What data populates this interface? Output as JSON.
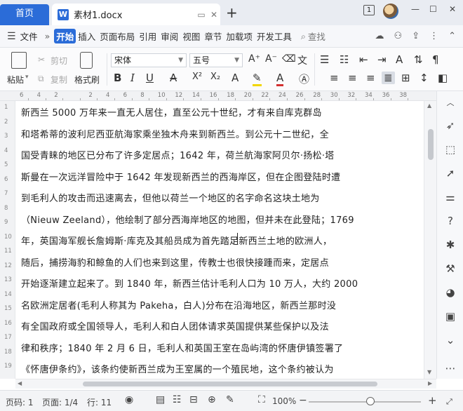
{
  "tabs": {
    "home": "首页",
    "doc_icon": "W",
    "doc_name": "素材1.docx",
    "new_tab": "+"
  },
  "window": {
    "badge": "1",
    "minimize": "—",
    "maximize": "☐",
    "close": "✕"
  },
  "menu": {
    "file": "文件",
    "items": [
      "开始",
      "插入",
      "页面布局",
      "引用",
      "审阅",
      "视图",
      "章节",
      "加载项",
      "开发工具"
    ],
    "active": "开始",
    "search": "查找"
  },
  "ribbon": {
    "paste": "粘贴",
    "cut": "剪切",
    "copy": "复制",
    "format_painter": "格式刷",
    "font_name": "宋体",
    "font_size": "五号",
    "bold": "B",
    "italic": "I",
    "underline": "U",
    "strike": "A",
    "superscript": "X²",
    "subscript": "X₂"
  },
  "ruler": {
    "marks": [
      "6",
      "4",
      "2",
      "",
      "2",
      "4",
      "6",
      "8",
      "10",
      "12",
      "14",
      "16",
      "18",
      "20",
      "22",
      "24",
      "26",
      "28",
      "30",
      "32",
      "34",
      "36",
      "38"
    ]
  },
  "gutter": {
    "marks": [
      "1",
      "2",
      "3",
      "4",
      "5",
      "6",
      "7",
      "8",
      "9",
      "10",
      "11",
      "12",
      "13",
      "14",
      "15",
      "16",
      "17",
      "18",
      "19"
    ]
  },
  "document": {
    "lines": [
      "新西兰 5000 万年来一直无人居住，直至公元十世纪，才有来自库克群岛",
      "和塔希蒂的波利尼西亚航海家乘坐独木舟来到新西兰。到公元十二世纪，全",
      "国受青睐的地区已分布了许多定居点；1642 年，荷兰航海家阿贝尔·扬松·塔",
      "斯曼在一次远洋冒险中于 1642 年发现新西兰的西海岸区，但在企图登陆时遭",
      "到毛利人的攻击而迅速离去，但他以荷兰一个地区的名字命名这块土地为",
      "（Nieuw Zeeland），他绘制了部分西海岸地区的地图，但并未在此登陆；1769",
      "年，英国海军舰长詹姆斯·库克及其船员成为首先踏足新西兰土地的欧洲人，",
      "随后，捕捞海豹和鲸鱼的人们也来到这里，传教士也很快接踵而来，定居点",
      "开始逐渐建立起来了。到 1840 年，新西兰估计毛利人口为 10 万人，大约 2000",
      "名欧洲定居者(毛利人称其为 Pakeha，白人)分布在沿海地区，新西兰那时没",
      "有全国政府或全国领导人，毛利人和白人团体请求英国提供某些保护以及法",
      "律和秩序；1840 年 2 月 6 日，毛利人和英国王室在岛屿湾的怀唐伊镇签署了",
      "《怀唐伊条约》，该条约使新西兰成为王室属的一个殖民地，这个条约被认为"
    ]
  },
  "status": {
    "page_num": "页码: 1",
    "pages": "页面: 1/4",
    "line": "行: 11",
    "zoom": "100%",
    "zoom_minus": "−",
    "zoom_plus": "+",
    "zoom_fraction": 0.55
  },
  "colors": {
    "accent": "#2b6cd8",
    "font_color": "#d33030",
    "highlight": "#f2d600"
  }
}
